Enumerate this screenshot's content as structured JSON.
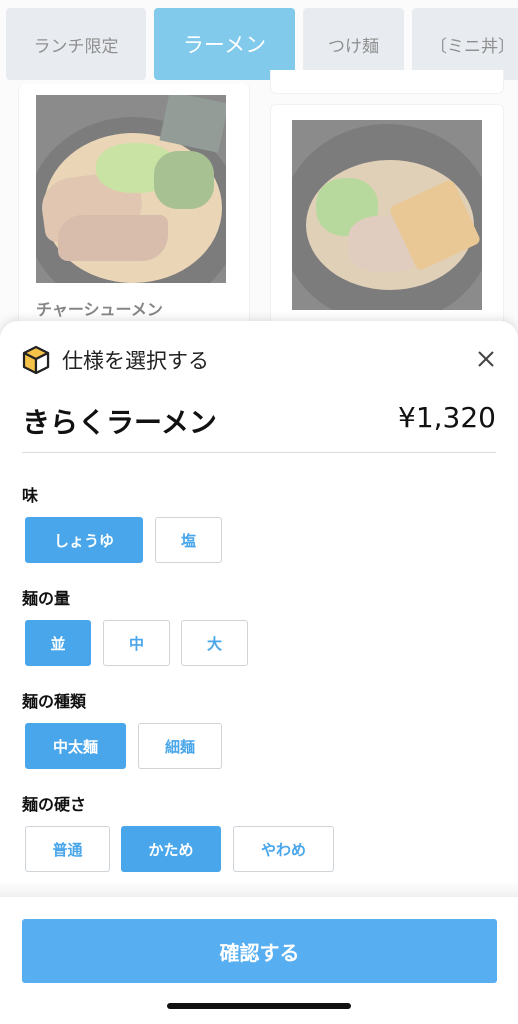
{
  "tabs": [
    {
      "label": "ランチ限定",
      "active": false
    },
    {
      "label": "ラーメン",
      "active": true
    },
    {
      "label": "つけ麺",
      "active": false
    },
    {
      "label": "〔ミニ丼〕",
      "active": false
    }
  ],
  "menu_cards": [
    {
      "title": "チャーシューメン"
    },
    {
      "title": ""
    }
  ],
  "sheet": {
    "title": "仕様を選択する",
    "product_name": "きらくラーメン",
    "price": "¥1,320",
    "sections": [
      {
        "label": "味",
        "options": [
          {
            "label": "しょうゆ",
            "selected": true
          },
          {
            "label": "塩",
            "selected": false
          }
        ]
      },
      {
        "label": "麺の量",
        "options": [
          {
            "label": "並",
            "selected": true
          },
          {
            "label": "中",
            "selected": false
          },
          {
            "label": "大",
            "selected": false
          }
        ]
      },
      {
        "label": "麺の種類",
        "options": [
          {
            "label": "中太麺",
            "selected": true
          },
          {
            "label": "細麺",
            "selected": false
          }
        ]
      },
      {
        "label": "麺の硬さ",
        "options": [
          {
            "label": "普通",
            "selected": false
          },
          {
            "label": "かため",
            "selected": true
          },
          {
            "label": "やわめ",
            "selected": false
          }
        ]
      }
    ],
    "confirm_label": "確認する"
  },
  "colors": {
    "accent": "#4aa6ea",
    "tab_active": "#1b9fdc",
    "tab_inactive": "#d6dde3"
  },
  "icons": {
    "header": "cube-icon",
    "close": "close-icon"
  }
}
